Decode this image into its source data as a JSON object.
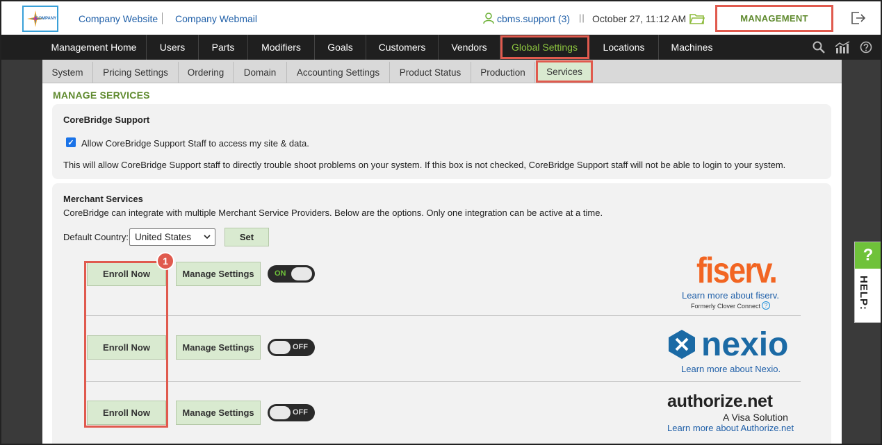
{
  "header": {
    "links": [
      "Company Website",
      "Company Webmail"
    ],
    "user": "cbms.support (3)",
    "datetime": "October 27, 11:12 AM",
    "management": "MANAGEMENT",
    "logo_text": "COMPANY"
  },
  "mainnav": {
    "items": [
      "Management Home",
      "Users",
      "Parts",
      "Modifiers",
      "Goals",
      "Customers",
      "Vendors",
      "Global Settings",
      "Locations",
      "Machines"
    ],
    "active": "Global Settings"
  },
  "subnav": {
    "tabs": [
      "System",
      "Pricing Settings",
      "Ordering",
      "Domain",
      "Accounting Settings",
      "Product Status",
      "Production",
      "Services"
    ],
    "active": "Services"
  },
  "page_title": "MANAGE SERVICES",
  "support": {
    "title": "CoreBridge Support",
    "checkbox_label": "Allow CoreBridge Support Staff to access my site & data.",
    "checked": true,
    "note": "This will allow CoreBridge Support staff to directly trouble shoot problems on your system. If this box is not checked, CoreBridge Support staff will not be able to login to your system."
  },
  "merchant": {
    "title": "Merchant Services",
    "desc": "CoreBridge can integrate with multiple Merchant Service Providers. Below are the options. Only one integration can be active at a time.",
    "country_label": "Default Country:",
    "country_value": "United States",
    "set_label": "Set",
    "enroll_label": "Enroll Now",
    "manage_label": "Manage Settings",
    "providers": [
      {
        "logo_text": "fiserv.",
        "link": "Learn more about fiserv.",
        "note": "Formerly Clover Connect",
        "toggle": "ON"
      },
      {
        "logo_text": "nexio",
        "link": "Learn more about Nexio.",
        "toggle": "OFF"
      },
      {
        "logo_text": "authorize.net",
        "sub": "A Visa Solution",
        "link": "Learn more about Authorize.net",
        "toggle": "OFF"
      }
    ]
  },
  "annotation_badge": "1",
  "help": {
    "q": "?",
    "text": "HELP:"
  },
  "colors": {
    "accent_green": "#5f8a2e",
    "highlight_red": "#e05a4e",
    "button_green": "#d9ead0",
    "nav_bg": "#1f1f1f"
  }
}
